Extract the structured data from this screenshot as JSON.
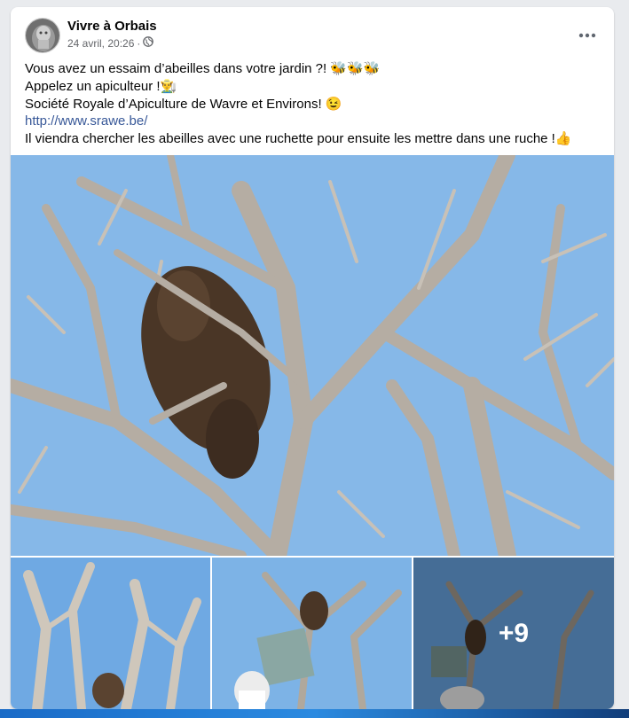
{
  "post": {
    "page_name": "Vivre à Orbais",
    "timestamp": "24 avril, 20:26",
    "separator": "·",
    "privacy_icon": "globe-icon",
    "more_icon": "more-horizontal-icon",
    "lines": {
      "l1": "Vous avez un essaim d’abeilles dans votre jardin ?! ",
      "l2": "Appelez un apiculteur !",
      "l3": "Société Royale d’Apiculture de Wavre et Environs! ",
      "link": "http://www.srawe.be/",
      "l5": "Il viendra chercher les abeilles avec une ruchette pour ensuite les mettre dans une ruche !"
    },
    "emojis": {
      "bees": "🐝🐝🐝",
      "beekeeper": "👨‍🌾",
      "wink": "😉",
      "thumb": "👍"
    },
    "extra_photos": "+9"
  },
  "colors": {
    "sky": "#7fb4e6",
    "branch": "#a8a29a",
    "swarm": "#4a3626",
    "link": "#385898"
  }
}
